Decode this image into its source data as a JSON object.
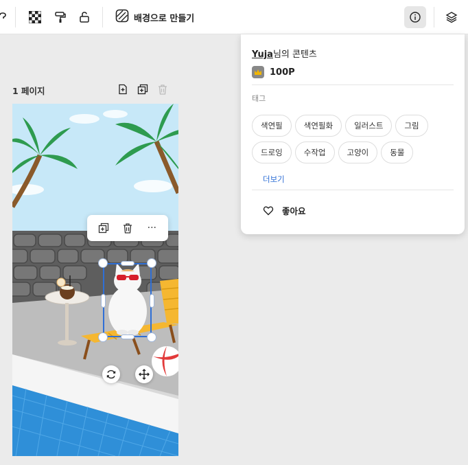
{
  "toolbar": {
    "make_background_label": "배경으로 만들기"
  },
  "page": {
    "label": "1 페이지"
  },
  "panel": {
    "owner_name": "Yuja",
    "owner_suffix": "님의 콘텐츠",
    "points": "100P",
    "tag_title": "태그",
    "tags": [
      "색연필",
      "색연필화",
      "일러스트",
      "그림",
      "드로잉",
      "수작업",
      "고양이",
      "동물"
    ],
    "more_label": "더보기",
    "like_label": "좋아요"
  },
  "floating_toolbar": {
    "more_label": "···"
  },
  "colors": {
    "selection": "#2f6fd6",
    "link": "#2f6fd6",
    "crown": "#f2b600"
  }
}
